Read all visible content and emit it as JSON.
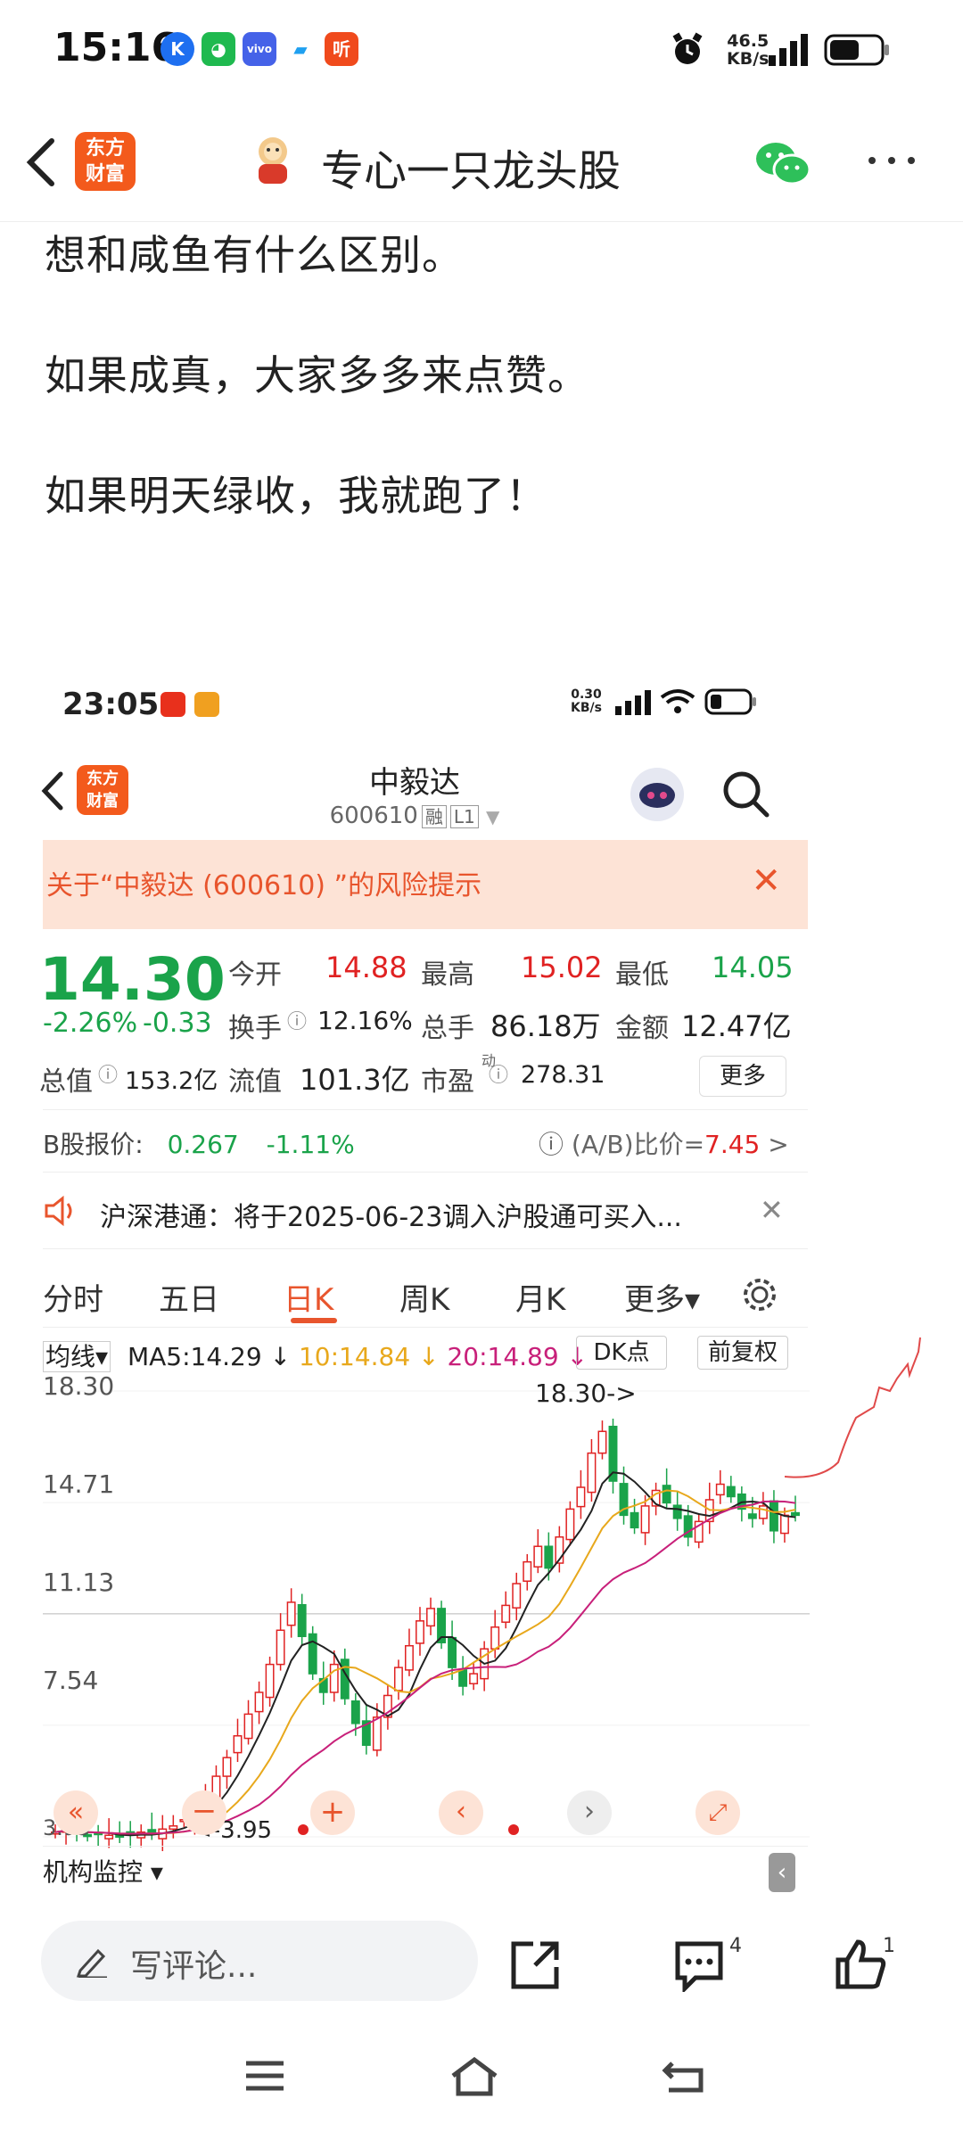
{
  "status_bar": {
    "time": "15:16",
    "app_icons": [
      "kuwo-icon",
      "wechat-icon",
      "vivo-icon",
      "tencent-meeting-icon",
      "listen-icon"
    ],
    "net_speed_value": "46.5",
    "net_speed_unit": "KB/s",
    "listen_label": "听"
  },
  "top_nav": {
    "logo_line1": "东方",
    "logo_line2": "财富",
    "title": "专心一只龙头股"
  },
  "article": {
    "line1": "想和咸鱼有什么区别。",
    "line2": "如果成真，大家多多来点赞。",
    "line3": "如果明天绿收，我就跑了！"
  },
  "embedded": {
    "status_time": "23:05",
    "net_speed_value": "0.30",
    "net_speed_unit": "KB/s",
    "logo_line1": "东方",
    "logo_line2": "财富",
    "stock_name": "中毅达",
    "stock_code": "600610",
    "tag1": "融",
    "tag2": "L1",
    "risk_text": "关于“中毅达 (600610) ”的风险提示",
    "risk_close": "✕",
    "price": "14.30",
    "pct_change": "-2.26%",
    "abs_change": "-0.33",
    "quote": {
      "open_label": "今开",
      "open_value": "14.88",
      "high_label": "最高",
      "high_value": "15.02",
      "low_label": "最低",
      "low_value": "14.05",
      "turnover_label": "换手",
      "turnover_value": "12.16%",
      "volume_label": "总手",
      "volume_value": "86.18万",
      "amount_label": "金额",
      "amount_value": "12.47亿",
      "mktcap_label": "总值",
      "mktcap_value": "153.2亿",
      "float_label": "流值",
      "float_value": "101.3亿",
      "pe_label": "市盈",
      "pe_sup": "动",
      "pe_value": "278.31",
      "more_label": "更多"
    },
    "bshare": {
      "label": "B股报价:",
      "price": "0.267",
      "change": "-1.11%",
      "ratio_label": "(A/B)比价=",
      "ratio_value": "7.45",
      "arrow": ">"
    },
    "announcement": "沪深港通：将于2025-06-23调入沪股通可买入...",
    "announcement_close": "✕",
    "kline_tabs": [
      "分时",
      "五日",
      "日K",
      "周K",
      "月K",
      "更多▾"
    ],
    "active_tab": "日K",
    "ma_row": {
      "label": "均线▾",
      "ma5": "MA5:14.29 ↓",
      "ma10": "10:14.84 ↓",
      "ma20": "20:14.89 ↓",
      "dk_button": "DK点",
      "adjust_button": "前复权"
    },
    "y_labels": [
      "18.30",
      "14.71",
      "11.13",
      "7.54",
      "3.95"
    ],
    "peak_label": "18.30->",
    "low_label": "<-3.95",
    "monitor_label": "机构监控 ▾",
    "colors": {
      "up": "#e02222",
      "down": "#1aa34a",
      "ma5": "#222222",
      "ma10": "#e8a81c",
      "ma20": "#c8207a",
      "accent": "#e8552d"
    }
  },
  "chart_data": {
    "type": "candlestick",
    "ylim": [
      3.95,
      18.3
    ],
    "y_ticks": [
      18.3,
      14.71,
      11.13,
      7.54,
      3.95
    ],
    "ma5_last": 14.29,
    "ma10_last": 14.84,
    "ma20_last": 14.89,
    "close_series": [
      4.1,
      4.2,
      4.1,
      4.0,
      4.05,
      4.0,
      3.95,
      4.0,
      4.1,
      4.05,
      4.2,
      4.3,
      4.5,
      4.8,
      5.2,
      5.9,
      6.5,
      7.2,
      7.9,
      8.6,
      9.5,
      10.6,
      11.5,
      10.4,
      9.2,
      8.6,
      9.5,
      8.4,
      7.6,
      6.9,
      7.8,
      8.5,
      9.4,
      10.1,
      10.9,
      11.3,
      10.2,
      9.4,
      8.8,
      9.2,
      10.0,
      10.7,
      11.4,
      12.1,
      12.8,
      13.3,
      12.6,
      13.6,
      14.5,
      15.2,
      16.3,
      17.0,
      15.4,
      14.3,
      13.9,
      14.6,
      15.1,
      14.7,
      14.2,
      13.6,
      14.1,
      14.8,
      15.3,
      14.9,
      14.5,
      14.2,
      14.6,
      13.8,
      14.3,
      14.3
    ]
  },
  "bottom_bar": {
    "comment_placeholder": "写评论...",
    "comment_count": "4",
    "like_count": "1"
  }
}
